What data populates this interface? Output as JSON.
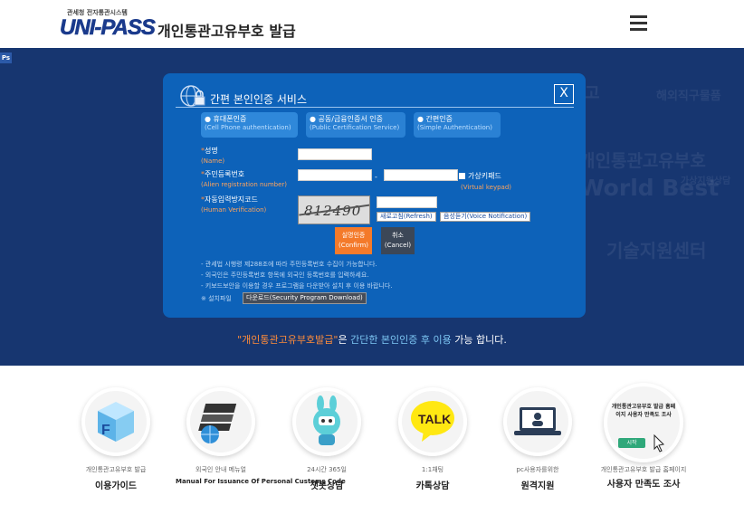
{
  "header": {
    "logo_sub": "관세청 전자통관시스템",
    "logo_brand": "UNI-PASS",
    "title": "개인통관고유부호 발급"
  },
  "hero": {
    "ps_badge": "Ps",
    "bg_words": [
      "해외직구물품",
      "개인통관고유부호",
      "World Best",
      "기술지원센터",
      "가상지원상담",
      "고"
    ],
    "tagline_quote": "\"개인통관고유부호발급\"",
    "tagline_mid": "은 ",
    "tagline_highlight": "간단한 본인인증 후 이용",
    "tagline_end": " 가능 합니다."
  },
  "modal": {
    "title": "간편 본인인증 서비스",
    "close": "X",
    "tabs": [
      {
        "label": "휴대폰인증",
        "en": "(Cell Phone authentication)"
      },
      {
        "label": "공동/금융인증서 인증",
        "en": "(Public Certification Service)"
      },
      {
        "label": "간편인증",
        "en": "(Simple Authentication)"
      }
    ],
    "name_label": "성명",
    "name_en": "(Name)",
    "reg_label": "주민등록번호",
    "reg_en": "(Alien registration number)",
    "reg_dash": "-",
    "vk_label": "가상키패드",
    "vk_en": "(Virtual keypad)",
    "captcha_label": "자동입력방지코드",
    "captcha_en": "(Human Verification)",
    "captcha_text": "812490",
    "refresh_btn": "새로고침(Refresh)",
    "voice_btn": "음성듣기(Voice Notification)",
    "confirm_ko": "실명인증",
    "confirm_en": "(Confirm)",
    "cancel_ko": "취소",
    "cancel_en": "(Cancel)",
    "notes": [
      "- 관세법 시행령 제288조에 따라 주민등록번호 수집이 가능합니다.",
      "- 외국인은 주민등록번호 항목에 외국인 등록번호를 입력하세요.",
      "- 키보드보안을 이용할 경우 프로그램을 다운받아 설치 후 이용 바랍니다."
    ],
    "install_prefix": "※ 설치파일",
    "download_btn": "다운로드(Security Program Download)"
  },
  "services": [
    {
      "sub": "개인통관고유부호 발급",
      "main": "이용가이드",
      "icon": "cube-f-icon"
    },
    {
      "sub": "외국인 안내 메뉴얼",
      "main": "Manual For Issuance Of Personal Customs Code",
      "icon": "book-globe-icon"
    },
    {
      "sub": "24시간 365일",
      "main": "챗봇상담",
      "icon": "robot-icon"
    },
    {
      "sub": "1:1채팅",
      "main": "카톡상담",
      "icon": "talk-bubble-icon"
    },
    {
      "sub": "pc사용자를위한",
      "main": "원격지원",
      "icon": "laptop-icon"
    },
    {
      "sub": "개인통관고유부호 발급 홈페이지",
      "main": "사용자 만족도 조사",
      "icon": "survey-icon",
      "circle_text": "개인통관고유부호 발급 홈페이지 사용자 만족도 조사",
      "start_label": "시작"
    }
  ],
  "colors": {
    "hero_bg": "#173670",
    "modal_bg": "#0d62b9",
    "accent_orange": "#f47a2a",
    "talk_yellow": "#ffe812"
  }
}
